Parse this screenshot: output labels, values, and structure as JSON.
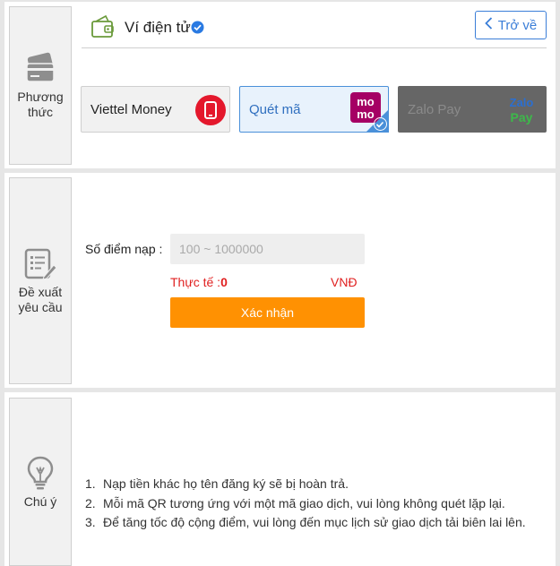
{
  "method_panel": {
    "side_label_line1": "Phương",
    "side_label_line2": "thức",
    "header_title": "Ví điện tử",
    "back_label": "Trở về",
    "methods": [
      {
        "label": "Viettel Money",
        "logo": "viettel-money-logo",
        "selected": false,
        "disabled": false
      },
      {
        "label": "Quét mã",
        "logo": "momo-logo",
        "logo_text": "mo mo",
        "selected": true,
        "disabled": false
      },
      {
        "label": "Zalo Pay",
        "logo": "zalopay-logo",
        "logo_text_1": "Zalo",
        "logo_text_2": "Pay",
        "selected": false,
        "disabled": true
      }
    ]
  },
  "request_panel": {
    "side_label_line1": "Đề xuất",
    "side_label_line2": "yêu cầu",
    "points_label": "Số điểm nạp :",
    "points_placeholder": "100 ~ 1000000",
    "points_value": "",
    "actual_label": "Thực tế :",
    "actual_value": "0",
    "currency": "VNĐ",
    "confirm_label": "Xác nhận"
  },
  "notes_panel": {
    "side_label": "Chú ý",
    "items": [
      {
        "num": "1.",
        "text": "Nạp tiền khác họ tên đăng ký sẽ bị hoàn trả."
      },
      {
        "num": "2.",
        "text": "Mỗi mã QR tương ứng với một mã giao dịch, vui lòng không quét lặp lại."
      },
      {
        "num": "3.",
        "text": "Để tăng tốc độ cộng điểm, vui lòng đến mục lịch sử giao dịch tải biên lai lên."
      }
    ]
  },
  "colors": {
    "accent_blue": "#3b7ed8",
    "confirm_orange": "#ff9102",
    "warning_red": "#e02020",
    "momo_pink": "#a50064",
    "viettel_red": "#e4182c",
    "zalo_green": "#3db94a"
  }
}
